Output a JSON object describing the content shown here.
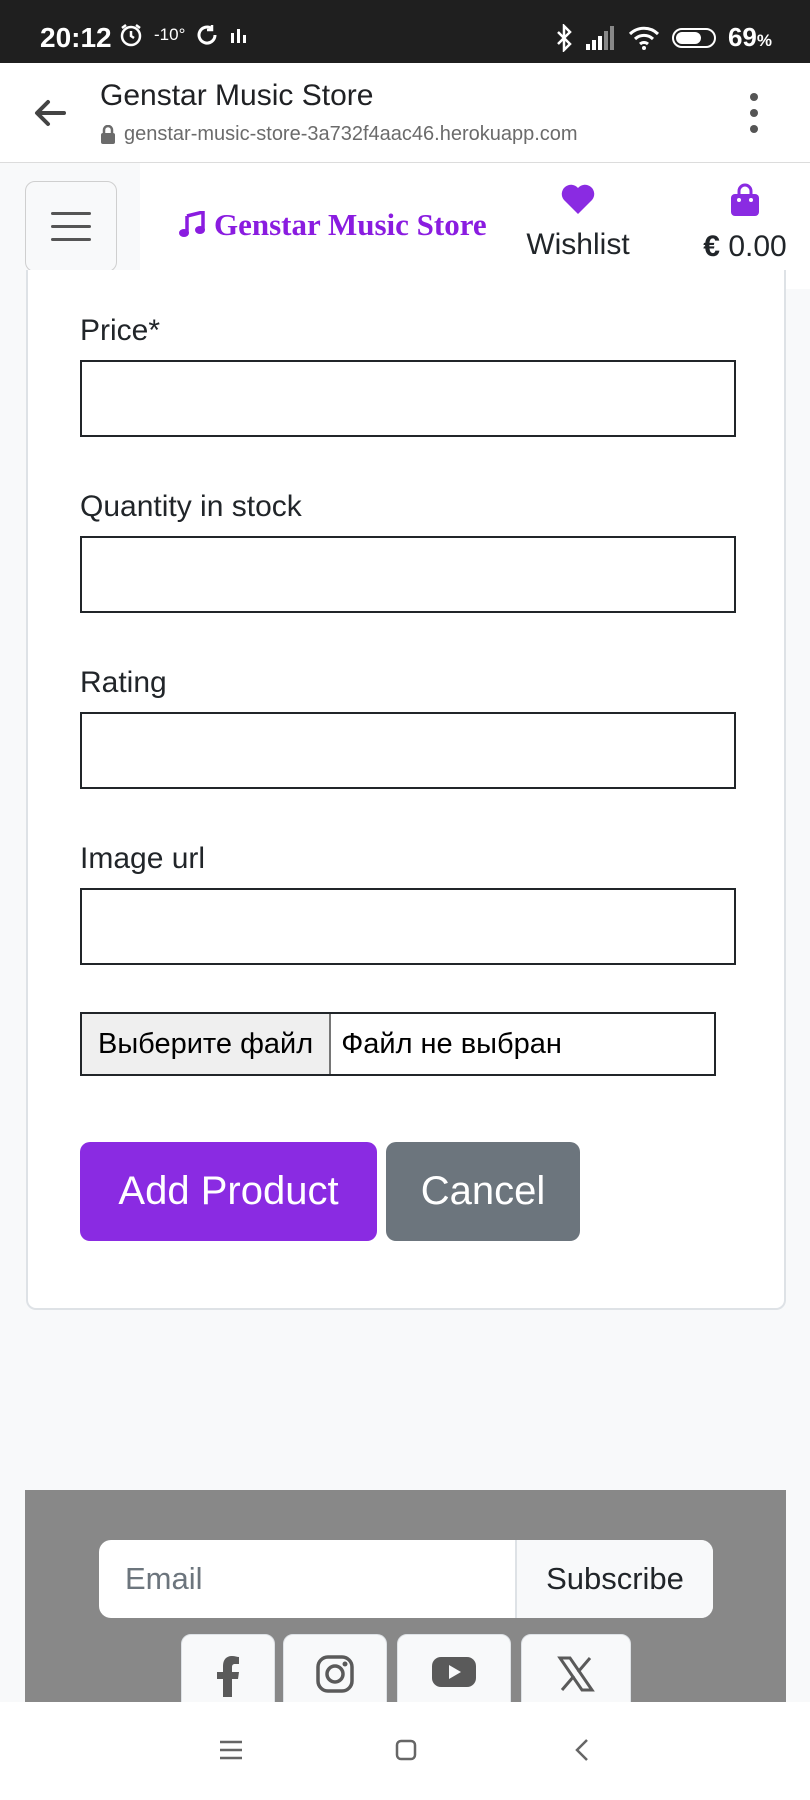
{
  "status_bar": {
    "time": "20:12",
    "temperature": "-10°",
    "battery_percent": "69",
    "battery_unit": "%",
    "icons": [
      "alarm-icon",
      "sync-icon",
      "chart-icon",
      "bluetooth-icon",
      "signal-icon",
      "wifi-icon",
      "battery-icon"
    ]
  },
  "browser": {
    "page_title": "Genstar Music Store",
    "url": "genstar-music-store-3a732f4aac46.herokuapp.com"
  },
  "header": {
    "brand": "Genstar Music Store",
    "wishlist_label": "Wishlist",
    "cart_total": "0.00",
    "currency_symbol": "€",
    "accent_color": "#8a2be2"
  },
  "form": {
    "fields": [
      {
        "label": "Price*",
        "value": ""
      },
      {
        "label": "Quantity in stock",
        "value": ""
      },
      {
        "label": "Rating",
        "value": ""
      },
      {
        "label": "Image url",
        "value": ""
      }
    ],
    "file_button_label": "Выберите файл",
    "file_status": "Файл не выбран",
    "submit_label": "Add Product",
    "cancel_label": "Cancel"
  },
  "footer": {
    "email_placeholder": "Email",
    "subscribe_label": "Subscribe",
    "social": [
      "facebook-icon",
      "instagram-icon",
      "youtube-icon",
      "x-icon"
    ]
  }
}
